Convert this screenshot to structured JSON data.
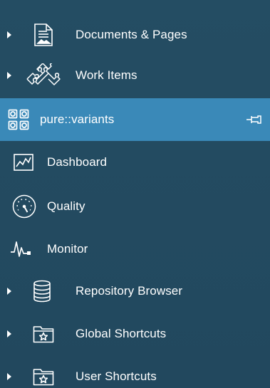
{
  "sidebar": {
    "items": [
      {
        "label": "Documents & Pages",
        "icon": "document-pages-icon",
        "expandable": true
      },
      {
        "label": "Work Items",
        "icon": "puzzle-icon",
        "expandable": true
      },
      {
        "label": "pure::variants",
        "icon": "variants-grid-icon",
        "expandable": false,
        "selected": true,
        "pin_icon": "pin-icon"
      },
      {
        "label": "Dashboard",
        "icon": "dashboard-chart-icon",
        "expandable": false
      },
      {
        "label": "Quality",
        "icon": "gauge-icon",
        "expandable": false
      },
      {
        "label": "Monitor",
        "icon": "heartbeat-monitor-icon",
        "expandable": false
      },
      {
        "label": "Repository Browser",
        "icon": "database-icon",
        "expandable": true
      },
      {
        "label": "Global Shortcuts",
        "icon": "star-folder-icon",
        "expandable": true
      },
      {
        "label": "User Shortcuts",
        "icon": "star-folder-icon",
        "expandable": true
      }
    ]
  },
  "colors": {
    "background": "#22495f",
    "selected": "#3a89b8",
    "text": "#ffffff"
  }
}
